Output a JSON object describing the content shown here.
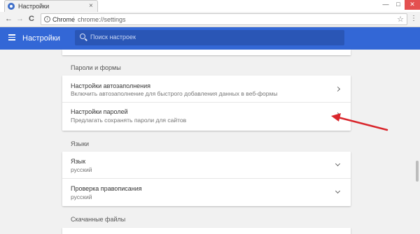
{
  "tab": {
    "title": "Настройки",
    "close": "×"
  },
  "window": {
    "minimize": "—",
    "maximize": "□",
    "close": "✕"
  },
  "toolbar": {
    "back": "←",
    "forward": "→",
    "reload": "C",
    "omnibox_chrome": "Chrome",
    "omnibox_sep": "|",
    "omnibox_url": "chrome://settings",
    "menu": "⋮"
  },
  "header": {
    "title": "Настройки",
    "search_placeholder": "Поиск настроек"
  },
  "sections": {
    "passwords": {
      "label": "Пароли и формы",
      "rows": [
        {
          "title": "Настройки автозаполнения",
          "subtitle": "Включить автозаполнение для быстрого добавления данных в веб-формы"
        },
        {
          "title": "Настройки паролей",
          "subtitle": "Предлагать сохранять пароли для сайтов"
        }
      ]
    },
    "languages": {
      "label": "Языки",
      "rows": [
        {
          "title": "Язык",
          "subtitle": "русский"
        },
        {
          "title": "Проверка правописания",
          "subtitle": "русский"
        }
      ]
    },
    "downloads": {
      "label": "Скачанные файлы"
    }
  },
  "colors": {
    "accent": "#3367d6",
    "arrow": "#d9262c"
  }
}
